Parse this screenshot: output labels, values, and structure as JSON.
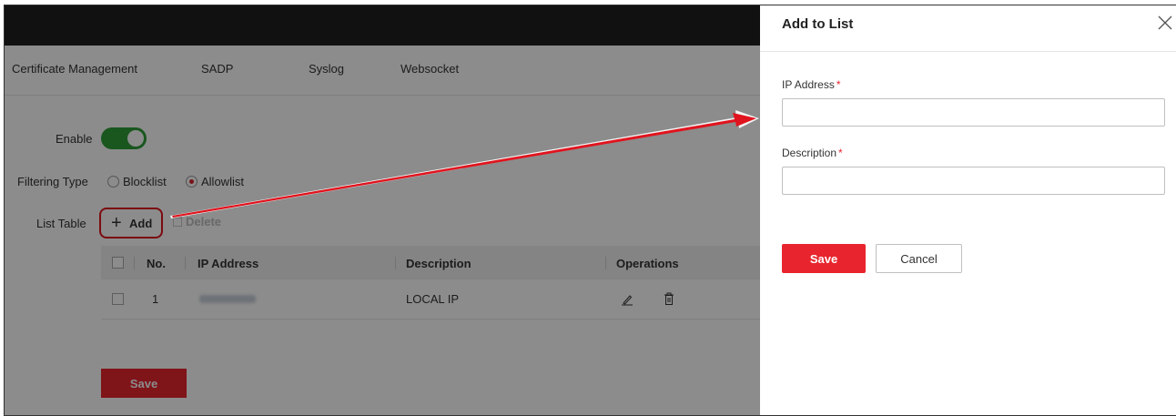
{
  "tabs": [
    "Certificate Management",
    "SADP",
    "Syslog",
    "Websocket"
  ],
  "settings": {
    "enable_label": "Enable",
    "enable_state": "on",
    "filtering_label": "Filtering Type",
    "filter_options": [
      "Blocklist",
      "Allowlist"
    ],
    "filter_selected": "Allowlist",
    "list_table_label": "List Table",
    "add_label": "Add",
    "add_symbol": "+",
    "delete_label": "Delete"
  },
  "table": {
    "columns": [
      "No.",
      "IP Address",
      "Description",
      "Operations"
    ],
    "rows": [
      {
        "no": "1",
        "description": "LOCAL IP",
        "operations": [
          "edit-icon",
          "delete-icon"
        ]
      }
    ]
  },
  "page_save_label": "Save",
  "panel": {
    "title": "Add to List",
    "fields": [
      {
        "label": "IP Address",
        "required_mark": "*",
        "value": ""
      },
      {
        "label": "Description",
        "required_mark": "*",
        "value": ""
      }
    ],
    "save_label": "Save",
    "cancel_label": "Cancel"
  },
  "colors": {
    "accent": "#e8252e",
    "toggle_on": "#2e9e3a",
    "annotation": "#e0141e"
  }
}
